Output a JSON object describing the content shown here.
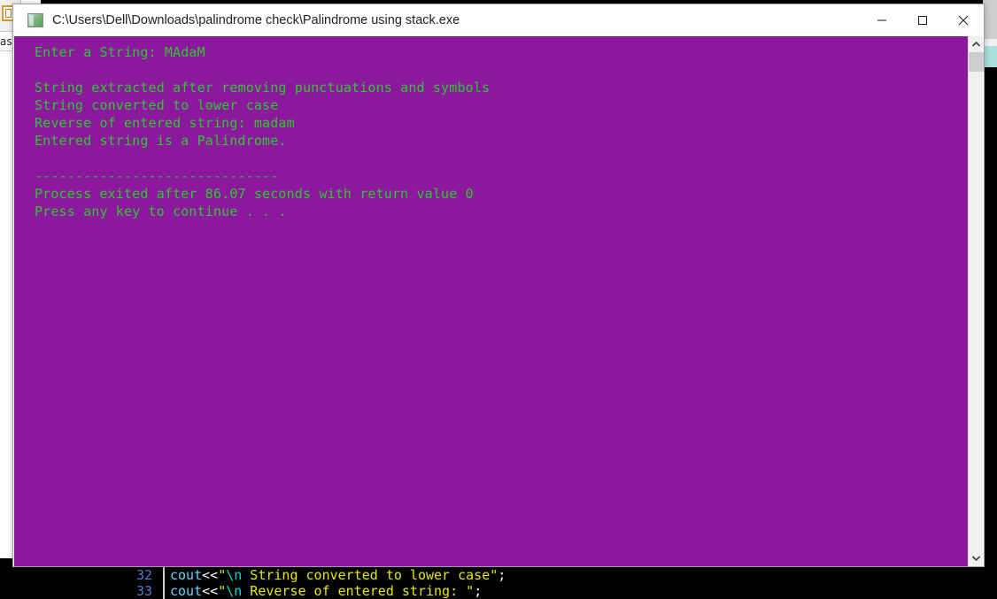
{
  "window": {
    "title": "C:\\Users\\Dell\\Downloads\\palindrome check\\Palindrome using stack.exe",
    "icon": "console-app-icon",
    "controls": {
      "minimize_label": "Minimize",
      "maximize_label": "Maximize",
      "close_label": "Close"
    },
    "colors": {
      "console_background": "#8B189D",
      "console_text": "#2fc72f",
      "titlebar_background": "#ffffff",
      "titlebar_text": "#1f1f1f"
    }
  },
  "console": {
    "lines": [
      "Enter a String: MAdaM",
      "",
      "String extracted after removing punctuations and symbols",
      "String converted to lower case",
      "Reverse of entered string: madam",
      "Entered string is a Palindrome.",
      "",
      "------------------------------",
      "Process exited after 86.07 seconds with return value 0",
      "Press any key to continue . . ."
    ],
    "entered_string": "MAdaM",
    "reversed_string": "madam",
    "result": "Entered string is a Palindrome.",
    "exit_seconds": "86.07",
    "return_value": "0"
  },
  "scrollbar": {
    "up_arrow": "chevron-up-icon",
    "down_arrow": "chevron-down-icon",
    "thumb": "scrollbar-thumb"
  },
  "editor": {
    "lines": [
      {
        "number": "32",
        "tokens": [
          {
            "text": "cout",
            "type": "fn"
          },
          {
            "text": "<<",
            "type": "op"
          },
          {
            "text": "\"",
            "type": "str"
          },
          {
            "text": "\\n",
            "type": "esc"
          },
          {
            "text": " String converted to lower case\"",
            "type": "str"
          },
          {
            "text": ";",
            "type": "pun"
          }
        ]
      },
      {
        "number": "33",
        "tokens": [
          {
            "text": "cout",
            "type": "fn"
          },
          {
            "text": "<<",
            "type": "op"
          },
          {
            "text": "\"",
            "type": "str"
          },
          {
            "text": "\\n",
            "type": "esc"
          },
          {
            "text": " Reverse of entered string: \"",
            "type": "str"
          },
          {
            "text": ";",
            "type": "pun"
          }
        ]
      }
    ]
  },
  "background": {
    "left_panel_text": "ass",
    "left_panel_icon": "app-icon"
  }
}
